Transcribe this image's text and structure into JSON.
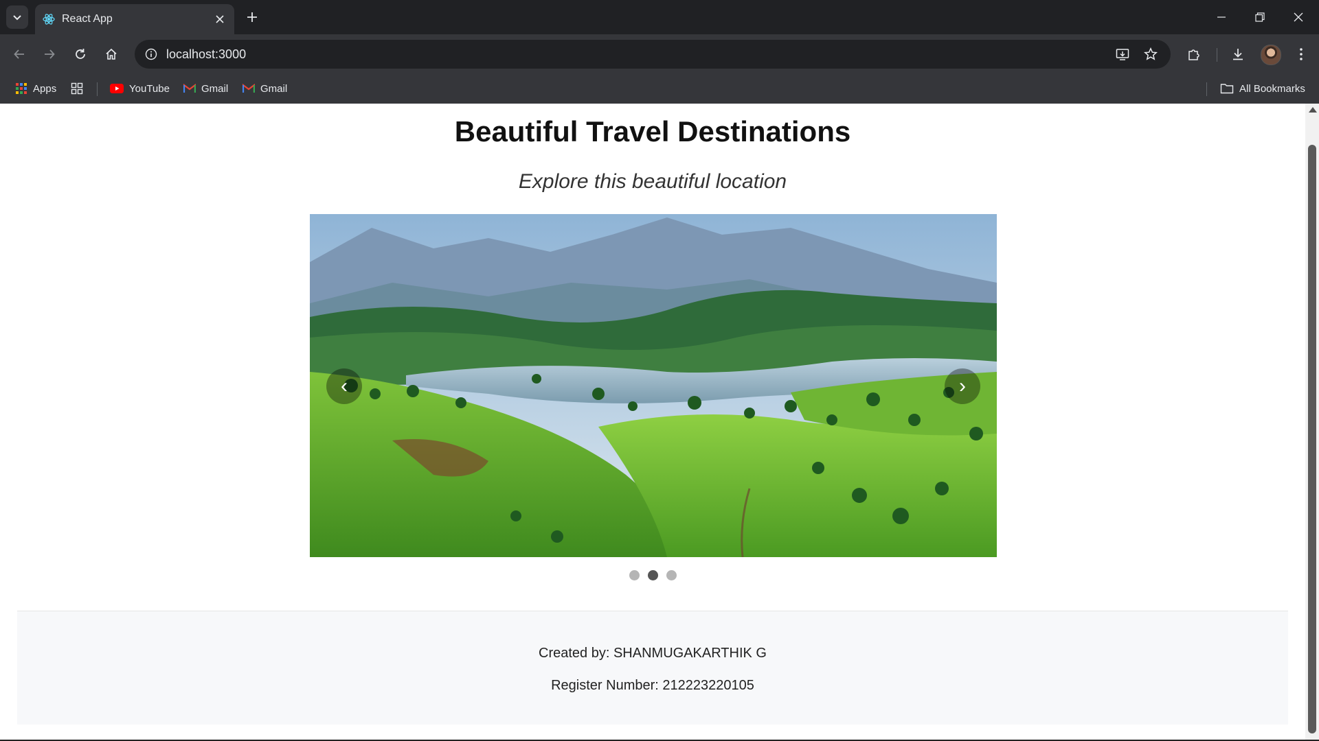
{
  "browser": {
    "tab": {
      "title": "React App"
    },
    "address_bar": {
      "url": "localhost:3000"
    },
    "bookmarks": [
      {
        "label": "Apps",
        "icon": "apps-grid-icon"
      },
      {
        "label": "YouTube",
        "icon": "youtube-icon"
      },
      {
        "label": "Gmail",
        "icon": "gmail-icon"
      },
      {
        "label": "Gmail",
        "icon": "gmail-icon"
      }
    ],
    "all_bookmarks_label": "All Bookmarks"
  },
  "page": {
    "title": "Beautiful Travel Destinations",
    "subtitle": "Explore this beautiful location",
    "carousel": {
      "prev_label": "‹",
      "next_label": "›",
      "slide_count": 3,
      "active_slide": 2,
      "image_description_icon": "landscape-photo"
    },
    "footer": {
      "created_by": "Created by: SHANMUGAKARTHIK G",
      "register_number": "Register Number: 212223220105"
    }
  },
  "colors": {
    "chrome_dark": "#202124",
    "chrome_toolbar": "#35363a",
    "page_bg": "#ffffff",
    "footer_bg": "#f7f8fa",
    "dot_active": "#555555",
    "dot_inactive": "#b5b5b5"
  }
}
